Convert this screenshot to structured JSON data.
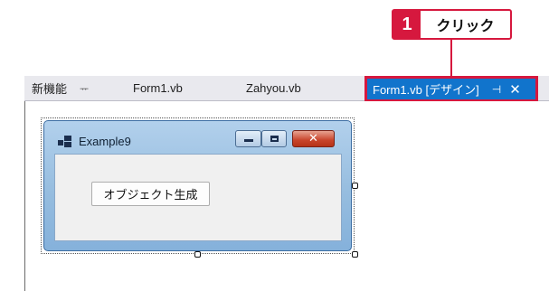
{
  "callout": {
    "number": "1",
    "text": "クリック"
  },
  "tabs": [
    {
      "label": "新機能",
      "pin": "ᅲ"
    },
    {
      "label": "Form1.vb"
    },
    {
      "label": "Zahyou.vb"
    }
  ],
  "active_tab": {
    "label": "Form1.vb [デザイン]",
    "pin": "⊣",
    "close": "✕"
  },
  "form": {
    "title": "Example9",
    "button_label": "オブジェクト生成",
    "close_glyph": "✕"
  },
  "colors": {
    "callout": "#d6183e",
    "active_tab": "#1174cc"
  }
}
